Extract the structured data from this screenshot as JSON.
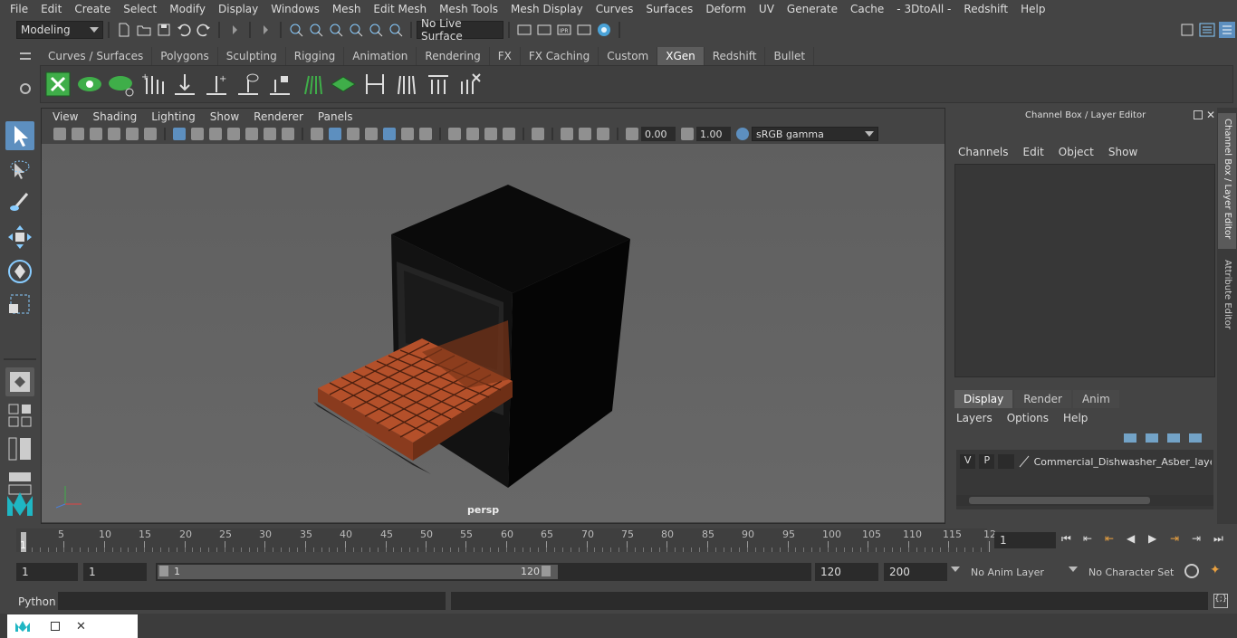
{
  "menus": [
    "File",
    "Edit",
    "Create",
    "Select",
    "Modify",
    "Display",
    "Windows",
    "Mesh",
    "Edit Mesh",
    "Mesh Tools",
    "Mesh Display",
    "Curves",
    "Surfaces",
    "Deform",
    "UV",
    "Generate",
    "Cache",
    "- 3DtoAll -",
    "Redshift",
    "Help"
  ],
  "status": {
    "mode": "Modeling",
    "live_surface": "No Live Surface"
  },
  "shelf_tabs": [
    "Curves / Surfaces",
    "Polygons",
    "Sculpting",
    "Rigging",
    "Animation",
    "Rendering",
    "FX",
    "FX Caching",
    "Custom",
    "XGen",
    "Redshift",
    "Bullet"
  ],
  "active_shelf_tab": "XGen",
  "viewport": {
    "menus": [
      "View",
      "Shading",
      "Lighting",
      "Show",
      "Renderer",
      "Panels"
    ],
    "exposure": "0.00",
    "gamma": "1.00",
    "color_space": "sRGB gamma",
    "camera_label": "persp"
  },
  "channel_box": {
    "title": "Channel Box / Layer Editor",
    "menus": [
      "Channels",
      "Edit",
      "Object",
      "Show"
    ],
    "layer_tabs": [
      "Display",
      "Render",
      "Anim"
    ],
    "active_layer_tab": "Display",
    "layer_menus": [
      "Layers",
      "Options",
      "Help"
    ],
    "layer": {
      "v": "V",
      "p": "P",
      "name": "Commercial_Dishwasher_Asber_layer"
    }
  },
  "side_tabs": [
    "Channel Box / Layer Editor",
    "Attribute Editor"
  ],
  "timeline": {
    "ticks": [
      "5",
      "10",
      "15",
      "20",
      "25",
      "30",
      "35",
      "40",
      "45",
      "50",
      "55",
      "60",
      "65",
      "70",
      "75",
      "80",
      "85",
      "90",
      "95",
      "100",
      "105",
      "110",
      "115",
      "12"
    ],
    "start_marker": "1",
    "current_frame": "1"
  },
  "range": {
    "start": "1",
    "playback_start": "1",
    "slider_start": "1",
    "slider_end": "120",
    "playback_end": "120",
    "end": "200",
    "anim_layer": "No Anim Layer",
    "character_set": "No Character Set"
  },
  "command": {
    "language": "Python"
  },
  "colors": {
    "accent": "#5d8fbf",
    "rack_orange": "#c65a2a",
    "xgen_green": "#3fae49"
  }
}
